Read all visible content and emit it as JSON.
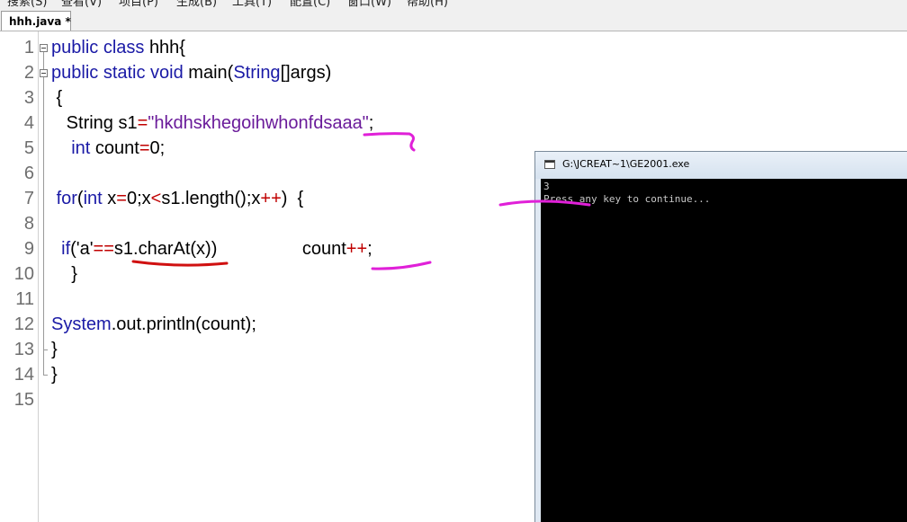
{
  "menubar": {
    "items": [
      "搜索(S)",
      "查看(V)",
      "项目(P)",
      "生成(B)",
      "工具(T)",
      "配置(C)",
      "窗口(W)",
      "帮助(H)"
    ]
  },
  "tab": {
    "label": "hhh.java *"
  },
  "editor": {
    "line_numbers": [
      "1",
      "2",
      "3",
      "4",
      "5",
      "6",
      "7",
      "8",
      "9",
      "10",
      "11",
      "12",
      "13",
      "14",
      "15"
    ],
    "lines": [
      [
        {
          "t": "public class ",
          "c": "kw"
        },
        {
          "t": "hhh{",
          "c": "plain"
        }
      ],
      [
        {
          "t": "public static void ",
          "c": "kw"
        },
        {
          "t": "main(",
          "c": "plain"
        },
        {
          "t": "String",
          "c": "kw"
        },
        {
          "t": "[]args)",
          "c": "plain"
        }
      ],
      [
        {
          "t": " {",
          "c": "plain"
        }
      ],
      [
        {
          "t": "   String ",
          "c": "plain"
        },
        {
          "t": "s1",
          "c": "plain"
        },
        {
          "t": "=",
          "c": "op"
        },
        {
          "t": "\"hkdhskhegoihwhonfdsaaa\"",
          "c": "str"
        },
        {
          "t": ";",
          "c": "plain"
        }
      ],
      [
        {
          "t": "    ",
          "c": "plain"
        },
        {
          "t": "int ",
          "c": "kw"
        },
        {
          "t": "count",
          "c": "plain"
        },
        {
          "t": "=",
          "c": "op"
        },
        {
          "t": "0;",
          "c": "plain"
        }
      ],
      [],
      [
        {
          "t": " ",
          "c": "plain"
        },
        {
          "t": "for",
          "c": "kw"
        },
        {
          "t": "(",
          "c": "plain"
        },
        {
          "t": "int ",
          "c": "kw"
        },
        {
          "t": "x",
          "c": "plain"
        },
        {
          "t": "=",
          "c": "op"
        },
        {
          "t": "0;x",
          "c": "plain"
        },
        {
          "t": "<",
          "c": "op"
        },
        {
          "t": "s1.length();x",
          "c": "plain"
        },
        {
          "t": "++",
          "c": "op"
        },
        {
          "t": ")  {",
          "c": "plain"
        }
      ],
      [],
      [
        {
          "t": "  ",
          "c": "plain"
        },
        {
          "t": "if",
          "c": "kw"
        },
        {
          "t": "('a'",
          "c": "plain"
        },
        {
          "t": "==",
          "c": "op"
        },
        {
          "t": "s1.charAt(x))                 count",
          "c": "plain"
        },
        {
          "t": "++",
          "c": "op"
        },
        {
          "t": ";",
          "c": "plain"
        }
      ],
      [
        {
          "t": "    }",
          "c": "plain"
        }
      ],
      [],
      [
        {
          "t": "System",
          "c": "kw"
        },
        {
          "t": ".out.println(count);",
          "c": "plain"
        }
      ],
      [
        {
          "t": "}",
          "c": "plain"
        }
      ],
      [
        {
          "t": "}",
          "c": "plain"
        }
      ],
      []
    ]
  },
  "console": {
    "title": "G:\\JCREAT~1\\GE2001.exe",
    "output": [
      "3",
      "Press any key to continue..."
    ]
  },
  "colors": {
    "keyword": "#1a1aa6",
    "string": "#6a1b9a",
    "operator": "#c00000",
    "line_number": "#6e6e6e",
    "annotation_magenta": "#e020d8",
    "annotation_red": "#d01010",
    "console_bg": "#000000"
  }
}
